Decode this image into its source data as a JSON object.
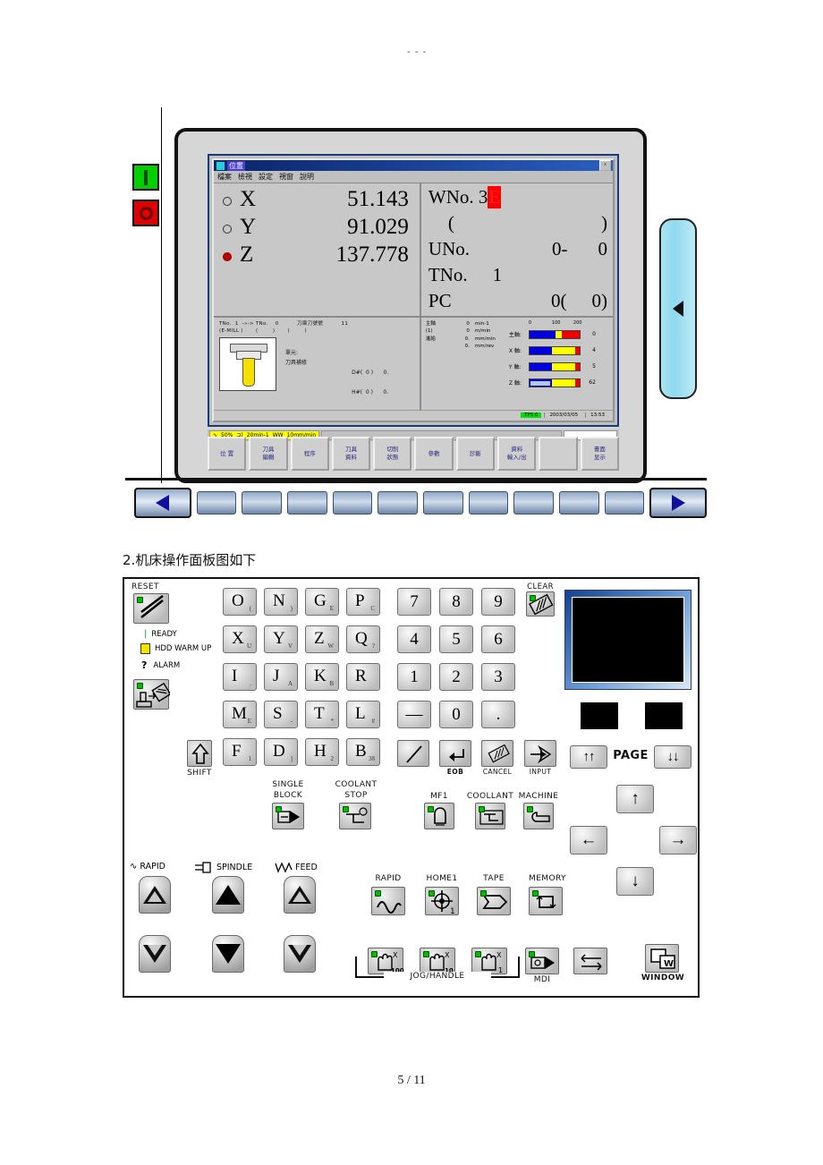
{
  "page": {
    "top_marker": "- - -",
    "footer": "5 / 11",
    "caption": "2.机床操作面板图如下"
  },
  "cnc_window": {
    "title": "位置",
    "close_label": "×",
    "menu": [
      "檔案",
      "檢視",
      "設定",
      "視窗",
      "說明"
    ],
    "axes": [
      {
        "name": "X",
        "value": "51.143",
        "active": false
      },
      {
        "name": "Y",
        "value": "91.029",
        "active": false
      },
      {
        "name": "Z",
        "value": "137.778",
        "active": true
      }
    ],
    "work_info": {
      "wno_label": "WNo.",
      "wno_value": "3",
      "wno_highlight": "E",
      "paren_open": "(",
      "paren_close": ")",
      "uno_label": "UNo.",
      "uno_value": "0-",
      "uno_value2": "0",
      "tno_label": "TNo.",
      "tno_value": "1",
      "pc_label": "PC",
      "pc_value": "0(",
      "pc_value2": "0)"
    },
    "tool_pane": {
      "line1": "TNo.  1  -»-> TNo.    0          刀庫刀號號          11",
      "line2": "(E-MILL )       (        )       (        )",
      "unit_label": "單元:",
      "unit_value": "刀具補修",
      "d_offset": "D#(  0 )      0.",
      "h_offset": "H#(  0 )      0."
    },
    "spindle_pane": {
      "rows": [
        {
          "label": "主軸",
          "value": "0",
          "unit": "min-1"
        },
        {
          "label": "(1)",
          "value": "0",
          "unit": "m/min"
        },
        {
          "label": "進給",
          "value": "0.",
          "unit": "mm/min"
        },
        {
          "label": "",
          "value": "0.",
          "unit": "mm/rev"
        }
      ]
    },
    "load_bars": {
      "scale": [
        "0",
        "100",
        "200"
      ],
      "items": [
        {
          "label": "主軸:",
          "value": "0",
          "blue_pct": 52,
          "yellow_pct": 13,
          "red_pct": 35
        },
        {
          "label": "X 軸:",
          "value": "4",
          "blue_pct": 44,
          "yellow_pct": 48,
          "red_pct": 8
        },
        {
          "label": "Y 軸:",
          "value": "5",
          "blue_pct": 44,
          "yellow_pct": 48,
          "red_pct": 8
        },
        {
          "label": "Z 軸:",
          "value": "62",
          "blue_pct": 44,
          "yellow_pct": 48,
          "red_pct": 8
        }
      ]
    },
    "status_bar": {
      "tps": "TPS 0",
      "date": "2003/03/05",
      "time": "13:53"
    },
    "override_bar": {
      "rapid_icon": "∿",
      "rapid_value": "50%",
      "spindle_value": "20min-1",
      "feed_icon": "WW",
      "feed_value": "10mm/min"
    },
    "function_keys": [
      {
        "line1": "位 置",
        "line2": ""
      },
      {
        "line1": "刀具",
        "line2": "編輯"
      },
      {
        "line1": "程序",
        "line2": ""
      },
      {
        "line1": "刀具",
        "line2": "資料"
      },
      {
        "line1": "切削",
        "line2": "狀態"
      },
      {
        "line1": "參數",
        "line2": ""
      },
      {
        "line1": "診斷",
        "line2": ""
      },
      {
        "line1": "資料",
        "line2": "輸入/出"
      },
      {
        "line1": "",
        "line2": ""
      },
      {
        "line1": "畫面",
        "line2": "显示"
      }
    ],
    "soft_key_count": 10
  },
  "power_buttons": {
    "on_label": "I",
    "off_label": "O"
  },
  "operation_panel": {
    "reset": {
      "label": "RESET"
    },
    "indicators": [
      {
        "symbol": "|",
        "label": "READY"
      },
      {
        "symbol": "▯",
        "label": "HDD WARM UP"
      },
      {
        "symbol": "?",
        "label": "ALARM"
      }
    ],
    "alpha_keys": [
      [
        {
          "main": "O",
          "sub": "("
        },
        {
          "main": "N",
          "sub": ")"
        },
        {
          "main": "G",
          "sub": "E"
        },
        {
          "main": "P",
          "sub": "C"
        }
      ],
      [
        {
          "main": "X",
          "sub": "U"
        },
        {
          "main": "Y",
          "sub": "V"
        },
        {
          "main": "Z",
          "sub": "W"
        },
        {
          "main": "Q",
          "sub": "?"
        }
      ],
      [
        {
          "main": "I",
          "sub": "."
        },
        {
          "main": "J",
          "sub": "A"
        },
        {
          "main": "K",
          "sub": "B"
        },
        {
          "main": "R",
          "sub": ""
        }
      ],
      [
        {
          "main": "M",
          "sub": "E"
        },
        {
          "main": "S",
          "sub": "-"
        },
        {
          "main": "T",
          "sub": "*"
        },
        {
          "main": "L",
          "sub": "#"
        }
      ],
      [
        {
          "main": "F",
          "sub": "1"
        },
        {
          "main": "D",
          "sub": "]"
        },
        {
          "main": "H",
          "sub": "2"
        },
        {
          "main": "B",
          "sub": "38"
        }
      ]
    ],
    "shift_label": "SHIFT",
    "num_keys": [
      [
        "7",
        "8",
        "9"
      ],
      [
        "4",
        "5",
        "6"
      ],
      [
        "1",
        "2",
        "3"
      ],
      [
        "—",
        "0",
        "."
      ]
    ],
    "clear_label": "CLEAR",
    "edit_keys": [
      {
        "name": "slash",
        "label": ""
      },
      {
        "name": "eob",
        "label": "EOB"
      },
      {
        "name": "cancel",
        "label": "CANCEL"
      },
      {
        "name": "input",
        "label": "INPUT"
      }
    ],
    "mid_buttons": [
      {
        "label1": "SINGLE",
        "label2": "BLOCK"
      },
      {
        "label1": "COOLANT",
        "label2": "STOP"
      }
    ],
    "aux_buttons": [
      {
        "label": "MF1"
      },
      {
        "label": "COOLLANT"
      },
      {
        "label": "MACHINE"
      }
    ],
    "override_groups": [
      {
        "label": "RAPID",
        "icon": "wave"
      },
      {
        "label": "SPINDLE",
        "icon": "plug"
      },
      {
        "label": "FEED",
        "icon": "zigzag"
      }
    ],
    "mode_buttons": [
      {
        "label": "RAPID",
        "icon": "wave"
      },
      {
        "label": "HOME1",
        "icon": "target"
      },
      {
        "label": "TAPE",
        "icon": "tape"
      },
      {
        "label": "MEMORY",
        "icon": "loop"
      }
    ],
    "jog_buttons": [
      {
        "mult": "100",
        "axis": "X"
      },
      {
        "mult": "10",
        "axis": "X"
      },
      {
        "mult": "1",
        "axis": "X"
      }
    ],
    "jog_label": "JOG/HANDLE",
    "mdi_label": "MDI",
    "window_label": "WINDOW",
    "page_label": "PAGE",
    "page_up": "↑↑",
    "page_down": "↓↓",
    "cursor_keys": [
      "↑",
      "←",
      "→",
      "↓"
    ]
  },
  "colors": {
    "accent_blue": "#0000cc",
    "bar_blue": "#0000dd",
    "bar_yellow": "#ffff00",
    "bar_red": "#ee0000",
    "green_led": "#00cc00",
    "power_on": "#00d000",
    "power_off": "#e00000"
  }
}
